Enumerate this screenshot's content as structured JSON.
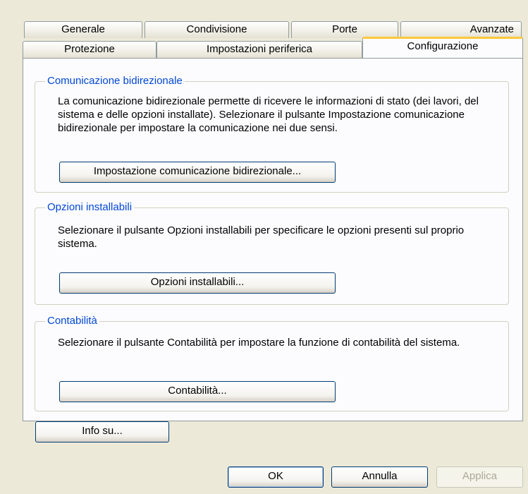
{
  "tabs_row1": [
    "Generale",
    "Condivisione",
    "Porte",
    "Avanzate"
  ],
  "tabs_row2": [
    "Protezione",
    "Impostazioni periferica",
    "Configurazione"
  ],
  "groups": {
    "bidir": {
      "title": "Comunicazione bidirezionale",
      "desc": "La comunicazione bidirezionale permette di ricevere le informazioni di stato (dei lavori, del sistema e delle opzioni installate). Selezionare il pulsante Impostazione comunicazione bidirezionale per impostare la comunicazione nei due sensi.",
      "button": "Impostazione comunicazione bidirezionale..."
    },
    "options": {
      "title": "Opzioni installabili",
      "desc": "Selezionare il pulsante Opzioni installabili per specificare le opzioni presenti sul proprio sistema.",
      "button": "Opzioni installabili..."
    },
    "accounting": {
      "title": "Contabilità",
      "desc": "Selezionare il pulsante Contabilità per impostare la funzione di contabilità del sistema.",
      "button": "Contabilità..."
    }
  },
  "about_button": "Info su...",
  "footer": {
    "ok": "OK",
    "cancel": "Annulla",
    "apply": "Applica"
  }
}
